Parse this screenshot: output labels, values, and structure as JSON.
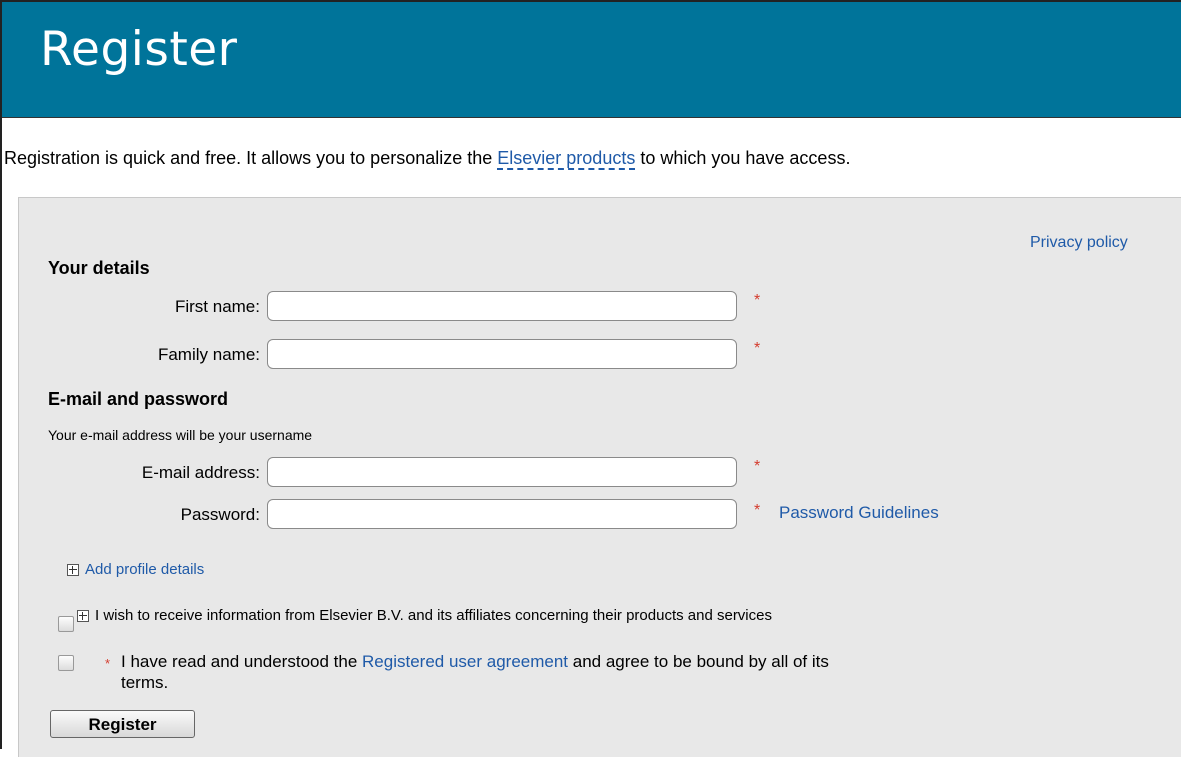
{
  "header": {
    "title": "Register"
  },
  "intro": {
    "before": "Registration is quick and free. It allows you to personalize the ",
    "link": "Elsevier products",
    "after": " to which you have access."
  },
  "privacy_policy": "Privacy policy",
  "your_details": {
    "heading": "Your details",
    "first_name_label": "First name:",
    "first_name_value": "",
    "family_name_label": "Family name:",
    "family_name_value": ""
  },
  "email_password": {
    "heading": "E-mail and password",
    "note": "Your e-mail address will be your username",
    "email_label": "E-mail address:",
    "email_value": "",
    "password_label": "Password:",
    "password_value": "",
    "password_guidelines": "Password Guidelines"
  },
  "required_marker": "*",
  "add_profile_details": "Add profile details",
  "marketing_checkbox": {
    "checked": false,
    "label": "I wish to receive information from Elsevier B.V. and its affiliates concerning their products and services"
  },
  "agreement_checkbox": {
    "checked": false,
    "before": "I have read and understood the ",
    "link": "Registered user agreement",
    "after": " and agree to be bound by all of its",
    "line2": "terms."
  },
  "register_button": "Register",
  "colors": {
    "header_bg": "#00749a",
    "link": "#1f5aa8",
    "required": "#d43c2e",
    "panel_bg": "#e8e8e8"
  }
}
